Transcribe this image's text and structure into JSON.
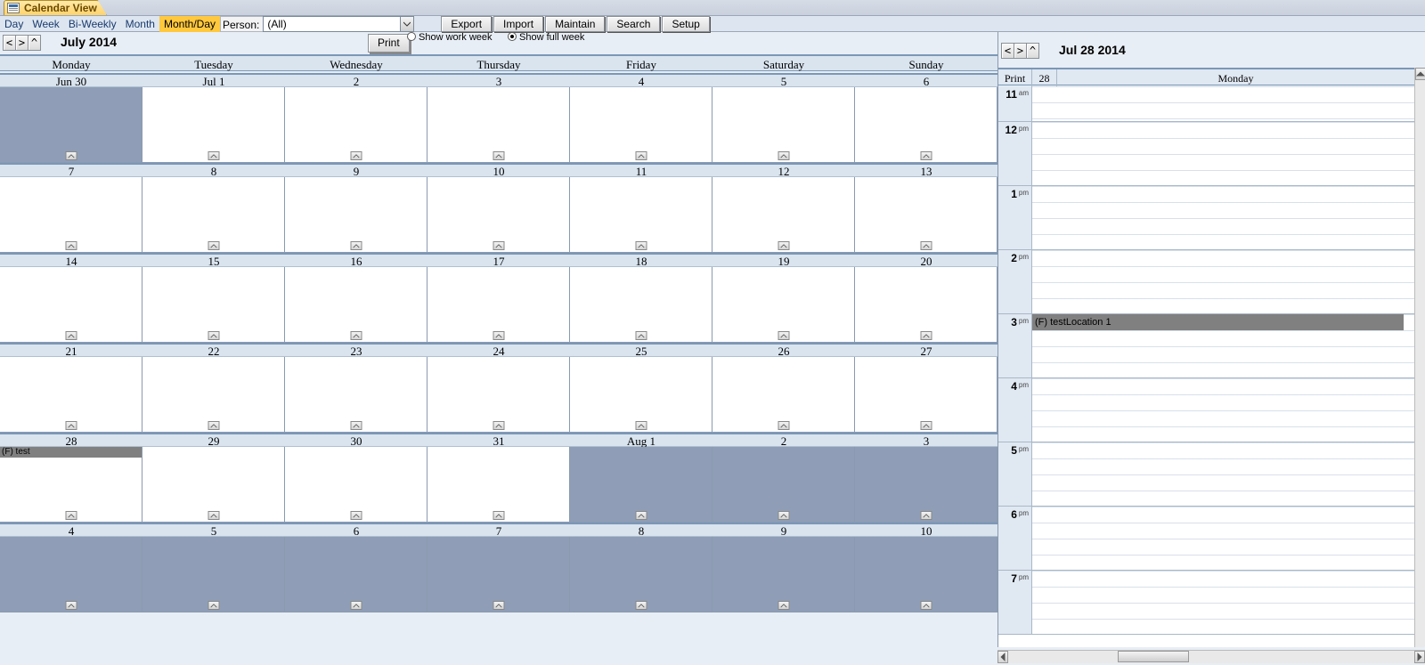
{
  "tab_title": "Calendar View",
  "view_buttons": [
    "Day",
    "Week",
    "Bi-Weekly",
    "Month",
    "Month/Day"
  ],
  "active_view": "Month/Day",
  "person_label": "Person:",
  "person_value": "(All)",
  "action_buttons": [
    "Export",
    "Import",
    "Maintain",
    "Search",
    "Setup"
  ],
  "month": {
    "nav": [
      "<",
      ">",
      "^"
    ],
    "title": "July 2014",
    "print_label": "Print",
    "radios": {
      "work": "Show work week",
      "full": "Show full week",
      "selected": "full"
    },
    "dow": [
      "Monday",
      "Tuesday",
      "Wednesday",
      "Thursday",
      "Friday",
      "Saturday",
      "Sunday"
    ],
    "weeks": [
      {
        "dates": [
          "Jun 30",
          "Jul 1",
          "2",
          "3",
          "4",
          "5",
          "6"
        ],
        "out": [
          true,
          false,
          false,
          false,
          false,
          false,
          false
        ],
        "events": {}
      },
      {
        "dates": [
          "7",
          "8",
          "9",
          "10",
          "11",
          "12",
          "13"
        ],
        "out": [
          false,
          false,
          false,
          false,
          false,
          false,
          false
        ],
        "events": {}
      },
      {
        "dates": [
          "14",
          "15",
          "16",
          "17",
          "18",
          "19",
          "20"
        ],
        "out": [
          false,
          false,
          false,
          false,
          false,
          false,
          false
        ],
        "events": {}
      },
      {
        "dates": [
          "21",
          "22",
          "23",
          "24",
          "25",
          "26",
          "27"
        ],
        "out": [
          false,
          false,
          false,
          false,
          false,
          false,
          false
        ],
        "events": {}
      },
      {
        "dates": [
          "28",
          "29",
          "30",
          "31",
          "Aug 1",
          "2",
          "3"
        ],
        "out": [
          false,
          false,
          false,
          false,
          true,
          true,
          true
        ],
        "events": {
          "0": "(F) test"
        }
      },
      {
        "dates": [
          "4",
          "5",
          "6",
          "7",
          "8",
          "9",
          "10"
        ],
        "out": [
          true,
          true,
          true,
          true,
          true,
          true,
          true
        ],
        "events": {}
      }
    ]
  },
  "day": {
    "nav": [
      "<",
      ">",
      "^"
    ],
    "title": "Jul 28 2014",
    "print_label": "Print",
    "header_day_number": "28",
    "header_dow": "Monday",
    "hours": [
      {
        "n": "11",
        "ap": "am"
      },
      {
        "n": "12",
        "ap": "pm"
      },
      {
        "n": "1",
        "ap": "pm"
      },
      {
        "n": "2",
        "ap": "pm"
      },
      {
        "n": "3",
        "ap": "pm"
      },
      {
        "n": "4",
        "ap": "pm"
      },
      {
        "n": "5",
        "ap": "pm"
      },
      {
        "n": "6",
        "ap": "pm"
      },
      {
        "n": "7",
        "ap": "pm"
      }
    ],
    "event": {
      "slot": 4,
      "text": "(F) testLocation 1"
    },
    "first_row_height": 40
  }
}
